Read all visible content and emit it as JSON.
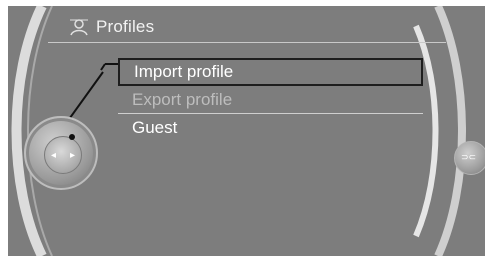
{
  "header": {
    "title": "Profiles",
    "icon": "profile-icon"
  },
  "menu": {
    "items": [
      {
        "label": "Import profile",
        "state": "selected"
      },
      {
        "label": "Export profile",
        "state": "disabled"
      },
      {
        "label": "Guest",
        "state": "normal"
      }
    ]
  },
  "controller": {
    "left_arrow": "◂",
    "right_arrow": "▸"
  },
  "right_button": {
    "label": "⊃⊂"
  },
  "colors": {
    "background": "#7d7d7d",
    "text": "#ffffff",
    "disabled_text": "#bdbdbd",
    "highlight_border": "#1e1e1e"
  }
}
